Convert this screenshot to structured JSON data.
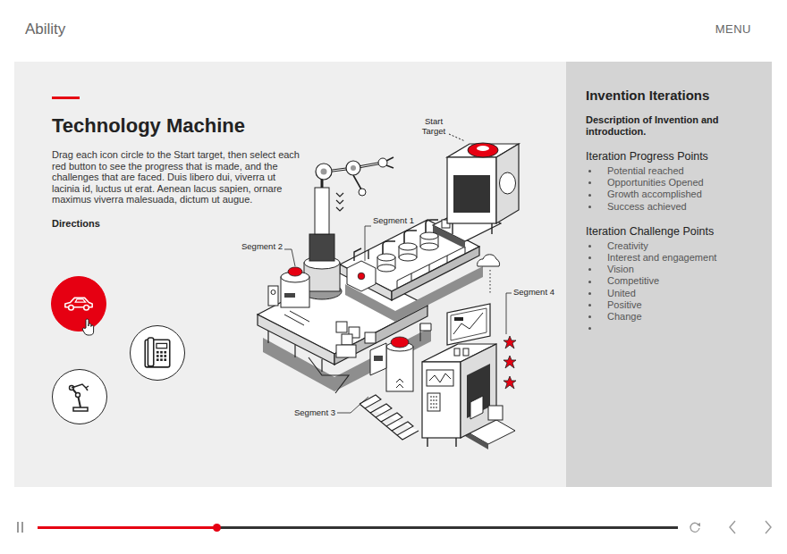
{
  "header": {
    "logo": "Ability",
    "menu": "MENU"
  },
  "intro": {
    "title": "Technology Machine",
    "text": "Drag each icon circle to the Start target, then select each red button to see the progress that is made, and the challenges that are faced. Duis libero dui, viverra ut lacinia id, luctus ut erat. Aenean lacus sapien, ornare maximus viverra malesuada, dictum ut augue.",
    "directions": "Directions"
  },
  "icon_circles": [
    {
      "kind": "car",
      "selected": true
    },
    {
      "kind": "phone",
      "selected": false
    },
    {
      "kind": "robot",
      "selected": false
    }
  ],
  "machine": {
    "start_target": "Start Target",
    "segments": [
      {
        "label": "Segment 1"
      },
      {
        "label": "Segment 2"
      },
      {
        "label": "Segment 3"
      },
      {
        "label": "Segment 4"
      }
    ]
  },
  "side_panel": {
    "title": "Invention Iterations",
    "description": "Description of Invention and introduction.",
    "sections": [
      {
        "heading": "Iteration Progress Points",
        "items": [
          "Potential reached",
          "Opportunities Opened",
          "Growth accomplished",
          "Success achieved"
        ]
      },
      {
        "heading": "Iteration Challenge Points",
        "items": [
          "Creativity",
          "Interest and engagement",
          "Vision",
          "Competitive",
          "United",
          "Positive",
          "Change",
          ""
        ]
      }
    ]
  },
  "player": {
    "playing": true,
    "level": 0.28
  }
}
